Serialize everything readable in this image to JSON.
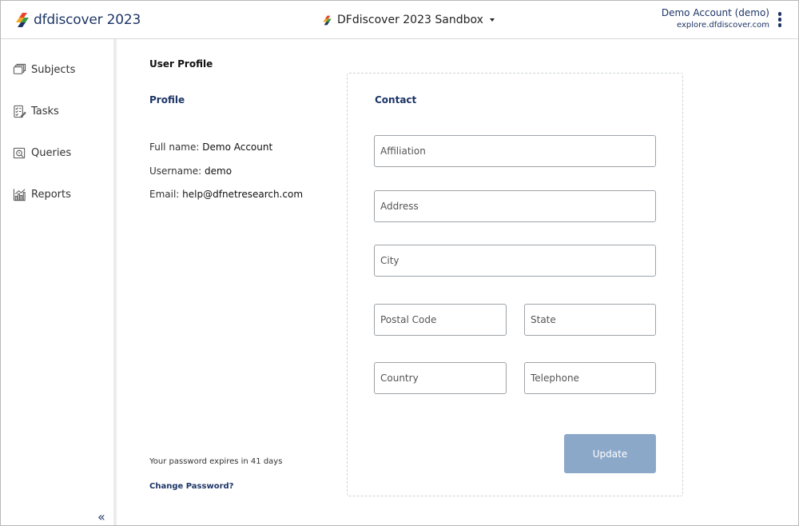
{
  "header": {
    "brand_name": "dfdiscover 2023",
    "study_name": "DFdiscover 2023 Sandbox",
    "account_name": "Demo Account (demo)",
    "account_server": "explore.dfdiscover.com",
    "brand_colors": [
      "#e8452c",
      "#f5a623",
      "#3b9c44",
      "#1d3566"
    ]
  },
  "sidebar": {
    "items": [
      {
        "label": "Subjects",
        "icon": "subjects-icon"
      },
      {
        "label": "Tasks",
        "icon": "tasks-icon"
      },
      {
        "label": "Queries",
        "icon": "queries-icon"
      },
      {
        "label": "Reports",
        "icon": "reports-icon"
      }
    ],
    "collapse_glyph": "«"
  },
  "main": {
    "title": "User Profile",
    "profile": {
      "heading": "Profile",
      "full_name_label": "Full name:",
      "full_name": "Demo Account",
      "username_label": "Username:",
      "username": "demo",
      "email_label": "Email:",
      "email": "help@dfnetresearch.com",
      "password_note": "Your password expires in 41 days",
      "change_password": "Change Password?"
    },
    "contact": {
      "heading": "Contact",
      "affiliation_placeholder": "Affiliation",
      "address_placeholder": "Address",
      "city_placeholder": "City",
      "postal_code_placeholder": "Postal Code",
      "state_placeholder": "State",
      "country_placeholder": "Country",
      "telephone_placeholder": "Telephone",
      "update_label": "Update"
    }
  },
  "colors": {
    "accent": "#1d3566",
    "button_disabled": "#8ba8c9",
    "field_border": "#9ea3a8",
    "dashed_border": "#cdd2d8"
  }
}
